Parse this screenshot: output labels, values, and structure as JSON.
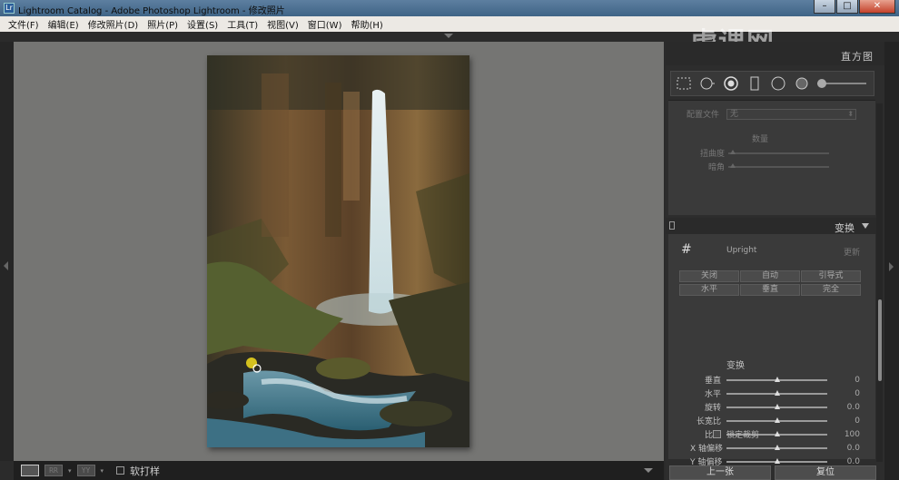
{
  "window": {
    "title": "Lightroom Catalog - Adobe Photoshop Lightroom - 修改照片",
    "app_icon": "Lr",
    "minimize": "–",
    "maximize": "□",
    "close": "✕"
  },
  "menu": [
    "文件(F)",
    "编辑(E)",
    "修改照片(D)",
    "照片(P)",
    "设置(S)",
    "工具(T)",
    "视图(V)",
    "窗口(W)",
    "帮助(H)"
  ],
  "watermark": "虎课网",
  "panel": {
    "module_name": "直方图",
    "lens": {
      "profile_label": "配置文件",
      "profile_value": "无",
      "amount_title": "数量",
      "sliders": [
        "扭曲度",
        "暗角"
      ]
    },
    "transform": {
      "header": "变换",
      "guide_icon": "#",
      "upright_label": "Upright",
      "update_label": "更新",
      "upright_buttons": [
        "关闭",
        "自动",
        "引导式",
        "水平",
        "垂直",
        "完全"
      ],
      "subtitle": "变换",
      "sliders": [
        {
          "label": "垂直",
          "value": "0"
        },
        {
          "label": "水平",
          "value": "0"
        },
        {
          "label": "旋转",
          "value": "0.0"
        },
        {
          "label": "长宽比",
          "value": "0"
        },
        {
          "label": "比例",
          "value": "100"
        },
        {
          "label": "X 轴偏移",
          "value": "0.0"
        },
        {
          "label": "Y 轴偏移",
          "value": "0.0"
        }
      ],
      "lock_crop": "锁定裁剪"
    },
    "prev_button": "上一张",
    "reset_button": "复位"
  },
  "toolbar": {
    "loupe_icon": "",
    "compare_icon": "RR",
    "survey_icon": "YY",
    "soft_proof_label": "软打样"
  }
}
